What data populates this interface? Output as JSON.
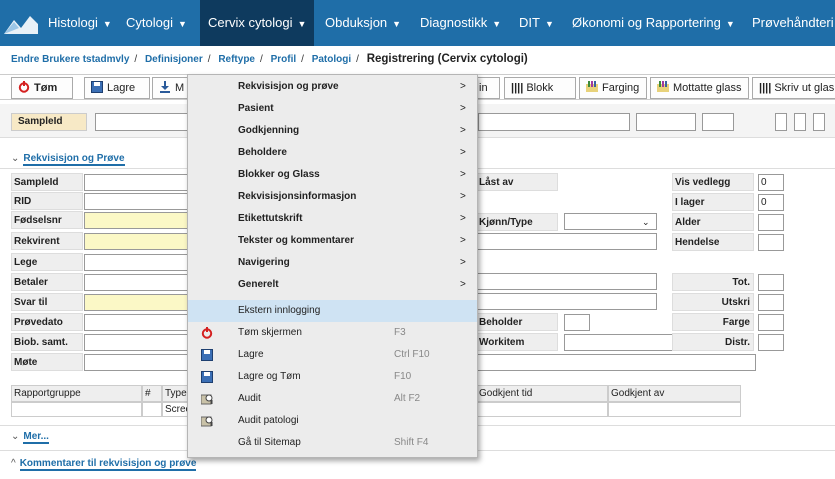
{
  "nav": {
    "items": [
      {
        "label": "Histologi",
        "has_caret": true
      },
      {
        "label": "Cytologi",
        "has_caret": true
      },
      {
        "label": "Cervix cytologi",
        "has_caret": true
      },
      {
        "label": "Obduksjon",
        "has_caret": true
      },
      {
        "label": "Diagnostikk",
        "has_caret": true
      },
      {
        "label": "DIT",
        "has_caret": true
      },
      {
        "label": "Økonomi og Rapportering",
        "has_caret": true
      },
      {
        "label": "Prøvehåndteri",
        "has_caret": false
      }
    ],
    "caret": "▼"
  },
  "breadcrumb": {
    "items": [
      "Endre Brukere tstadmvly",
      "Definisjoner",
      "Reftype",
      "Profil",
      "Patologi"
    ],
    "separator": "/",
    "current": "Registrering (Cervix cytologi)"
  },
  "toolbar": {
    "buttons": [
      "Tøm",
      "Lagre",
      "M",
      "in",
      "Blokk",
      "Farging",
      "Mottatte glass",
      "Skriv ut glas"
    ]
  },
  "sample_bar": {
    "label": "SampleId"
  },
  "sections": {
    "rekvisisjon": "Rekvisisjon og Prøve",
    "mer": "Mer...",
    "kommentarer": "Kommentarer til rekvisisjon og prøve"
  },
  "form": {
    "left_labels": [
      "SampleId",
      "RID",
      "Fødselsnr",
      "Rekvirent",
      "Lege",
      "Betaler",
      "Svar til",
      "Prøvedato",
      "Biob. samt.",
      "Møte"
    ],
    "mid_labels": [
      "Låst av",
      "Kjønn/Type",
      "Beholder",
      "Workitem"
    ],
    "right_labels": [
      "Vis vedlegg",
      "I lager",
      "Alder",
      "Hendelse",
      "Tot.",
      "Utskri",
      "Farge",
      "Distr."
    ],
    "vis_vedlegg_value": "0",
    "i_lager_value": "0"
  },
  "grid": {
    "headers": [
      "Rapportgruppe",
      "#",
      "Type",
      "Godkjent tid",
      "Godkjent av"
    ],
    "row": [
      "",
      "",
      "Scree",
      "",
      ""
    ]
  },
  "menu": {
    "submenus": [
      "Rekvisisjon og prøve",
      "Pasient",
      "Godkjenning",
      "Beholdere",
      "Blokker og Glass",
      "Rekvisisjonsinformasjon",
      "Etikettutskrift",
      "Tekster og kommentarer",
      "Navigering",
      "Generelt"
    ],
    "arrow": ">",
    "actions": [
      {
        "label": "Ekstern innlogging",
        "shortcut": "",
        "icon": ""
      },
      {
        "label": "Tøm skjermen",
        "shortcut": "F3",
        "icon": "clear-icon"
      },
      {
        "label": "Lagre",
        "shortcut": "Ctrl F10",
        "icon": "save-icon"
      },
      {
        "label": "Lagre og Tøm",
        "shortcut": "F10",
        "icon": "save-icon"
      },
      {
        "label": "Audit",
        "shortcut": "Alt F2",
        "icon": "audit-icon"
      },
      {
        "label": "Audit patologi",
        "shortcut": "",
        "icon": "audit-icon"
      },
      {
        "label": "Gå til Sitemap",
        "shortcut": "Shift F4",
        "icon": ""
      }
    ]
  },
  "colors": {
    "nav_bg": "#1f6ea8",
    "nav_active": "#0e3a5e",
    "link": "#1f6ea8",
    "highlight": "#cfe3f3",
    "required_field": "#fbf8c6"
  }
}
